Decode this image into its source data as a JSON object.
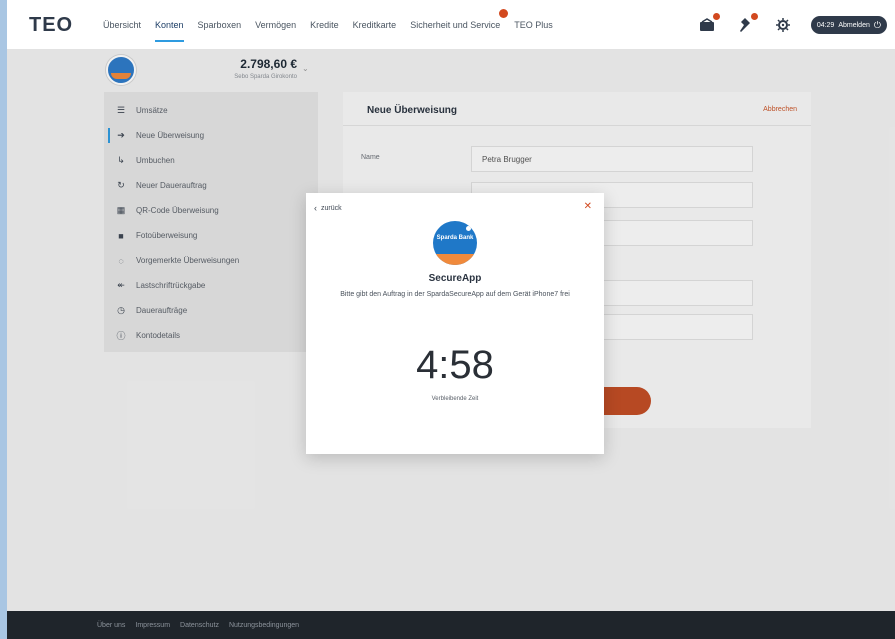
{
  "header": {
    "logo": "TEO",
    "nav": [
      {
        "label": "Übersicht"
      },
      {
        "label": "Konten"
      },
      {
        "label": "Sparboxen"
      },
      {
        "label": "Vermögen"
      },
      {
        "label": "Kredite"
      },
      {
        "label": "Kreditkarte"
      },
      {
        "label": "Sicherheit und Service"
      },
      {
        "label": "TEO Plus"
      }
    ],
    "active_nav": "Konten",
    "session_time": "04:29",
    "logout_label": "Abmelden"
  },
  "account": {
    "balance": "2.798,60 €",
    "name": "Sebo Sparda Girokonto"
  },
  "sidebar": {
    "items": [
      {
        "label": "Umsätze",
        "icon": "list-icon"
      },
      {
        "label": "Neue Überweisung",
        "icon": "arrow-right-icon"
      },
      {
        "label": "Umbuchen",
        "icon": "transfer-icon"
      },
      {
        "label": "Neuer Dauerauftrag",
        "icon": "repeat-icon"
      },
      {
        "label": "QR-Code Überweisung",
        "icon": "qr-code-icon"
      },
      {
        "label": "Fotoüberweisung",
        "icon": "camera-icon"
      },
      {
        "label": "Vorgemerkte Überweisungen",
        "icon": "clock-dashed-icon"
      },
      {
        "label": "Lastschriftrückgabe",
        "icon": "return-icon"
      },
      {
        "label": "Daueraufträge",
        "icon": "clock-icon"
      },
      {
        "label": "Kontodetails",
        "icon": "info-icon"
      }
    ],
    "active": "Neue Überweisung"
  },
  "transfer": {
    "title": "Neue Überweisung",
    "cancel_label": "Abbrechen",
    "name_label": "Name",
    "name_value": "Petra Brugger"
  },
  "modal": {
    "back_label": "zurück",
    "app_logo_text": "Sparda Bank",
    "app_name": "SecureApp",
    "message": "Bitte gibt den Auftrag in der SpardaSecureApp auf dem Gerät iPhone7 frei",
    "timer": "4:58",
    "timer_label": "Verbleibende Zeit"
  },
  "footer": {
    "links": [
      "Über uns",
      "Impressum",
      "Datenschutz",
      "Nutzungsbedingungen"
    ]
  },
  "colors": {
    "accent_blue": "#2e9be0",
    "accent_orange": "#c24d25",
    "footer_bg": "#1f252b"
  }
}
